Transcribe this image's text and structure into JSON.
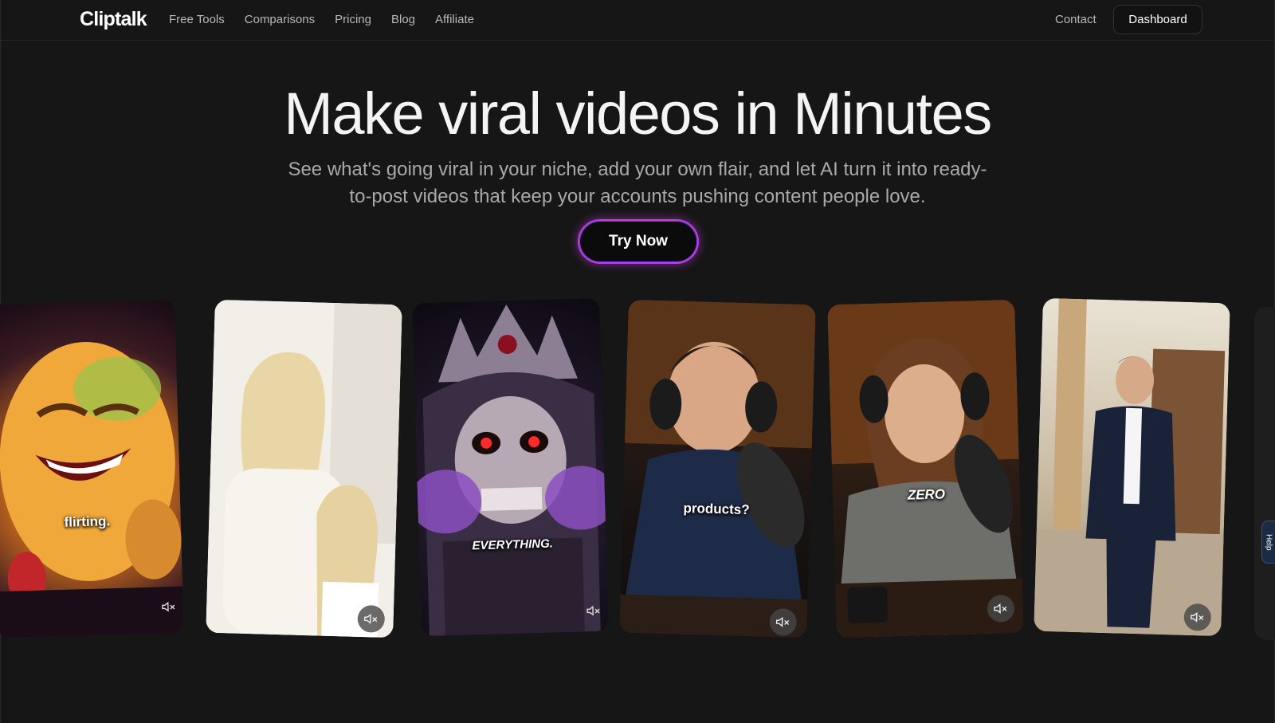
{
  "nav": {
    "logo": "Cliptalk",
    "links": [
      "Free Tools",
      "Comparisons",
      "Pricing",
      "Blog",
      "Affiliate"
    ],
    "contact": "Contact",
    "dashboard": "Dashboard"
  },
  "hero": {
    "title": "Make viral videos in Minutes",
    "subtitle": "See what's going viral in your niche, add your own flair, and let AI turn it into ready-to-post videos that keep your accounts pushing content people love.",
    "cta": "Try Now"
  },
  "carousel": {
    "cards": [
      {
        "caption": "flirting."
      },
      {
        "caption": ""
      },
      {
        "caption": "EVERYTHING."
      },
      {
        "caption": "products?"
      },
      {
        "caption": "ZERO"
      },
      {
        "caption": ""
      }
    ],
    "mute_icon": "speaker-muted-icon"
  },
  "help": "Help",
  "colors": {
    "background": "#161616",
    "cta_glow": "#c13bd8",
    "cta_glow_alt": "#7b3ff2"
  }
}
